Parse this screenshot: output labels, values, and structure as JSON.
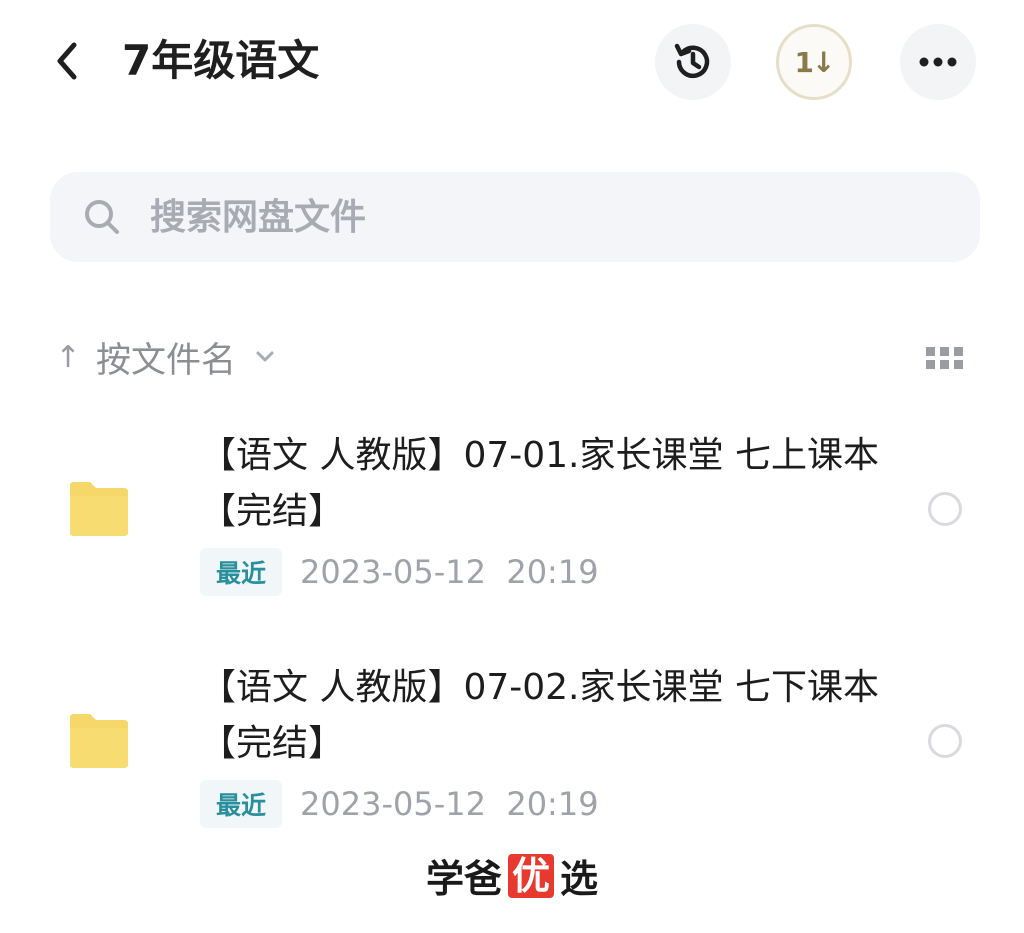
{
  "header": {
    "title": "7年级语文",
    "back_icon": "chevron-left-icon",
    "history_icon": "history-icon",
    "sort_toggle_label": "1↓",
    "more_icon": "more-icon"
  },
  "search": {
    "placeholder": "搜索网盘文件",
    "icon": "search-icon"
  },
  "sort": {
    "arrow": "↑",
    "label": "按文件名",
    "view_icon": "grid-view-icon"
  },
  "files": [
    {
      "name": "【语文 人教版】07-01.家长课堂 七上课本【完结】",
      "badge": "最近",
      "date": "2023-05-12  20:19",
      "icon": "folder-icon"
    },
    {
      "name": "【语文 人教版】07-02.家长课堂 七下课本【完结】",
      "badge": "最近",
      "date": "2023-05-12  20:19",
      "icon": "folder-icon"
    }
  ],
  "watermark": {
    "part1": "学爸",
    "badge": "优",
    "part2": "选"
  },
  "colors": {
    "folder": "#f5d76a",
    "badge_text": "#2a8f9c",
    "watermark_badge": "#e8392e"
  }
}
